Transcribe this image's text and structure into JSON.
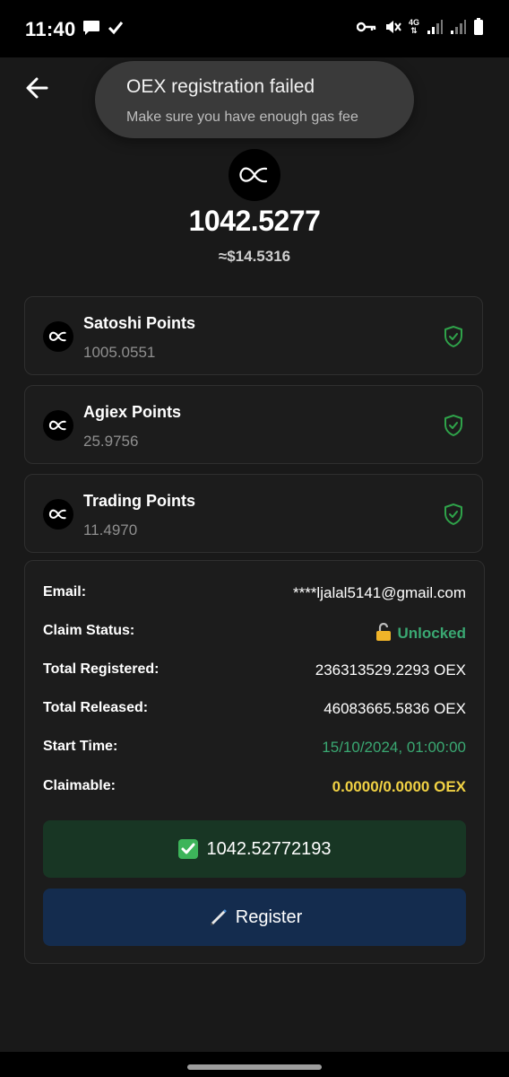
{
  "status_bar": {
    "time": "11:40",
    "network": "4G",
    "icons": [
      "chat-icon",
      "check-icon",
      "key-icon",
      "mute-icon",
      "signal-icon",
      "signal-icon",
      "battery-icon"
    ]
  },
  "toast": {
    "title": "OEX registration failed",
    "message": "Make sure you have enough gas fee"
  },
  "balance": {
    "total": "1042.5277",
    "usd": "≈$14.5316"
  },
  "points": [
    {
      "name": "Satoshi Points",
      "value": "1005.0551"
    },
    {
      "name": "Agiex Points",
      "value": "25.9756"
    },
    {
      "name": "Trading Points",
      "value": "11.4970"
    }
  ],
  "info": {
    "email_label": "Email:",
    "email_value": "****ljalal5141@gmail.com",
    "claim_status_label": "Claim Status:",
    "claim_status_value": "Unlocked",
    "total_registered_label": "Total Registered:",
    "total_registered_value": "236313529.2293 OEX",
    "total_released_label": "Total Released:",
    "total_released_value": "46083665.5836 OEX",
    "start_time_label": "Start Time:",
    "start_time_value": "15/10/2024, 01:00:00",
    "claimable_label": "Claimable:",
    "claimable_value": "0.0000/0.0000 OEX"
  },
  "buttons": {
    "claimed_label": "1042.52772193",
    "register_label": "Register"
  },
  "colors": {
    "background": "#191919",
    "accent_green": "#3aa872",
    "accent_yellow": "#f1d244",
    "claimed_button": "#183624",
    "register_button": "#142c4e",
    "shield_green": "#2fa34a"
  }
}
